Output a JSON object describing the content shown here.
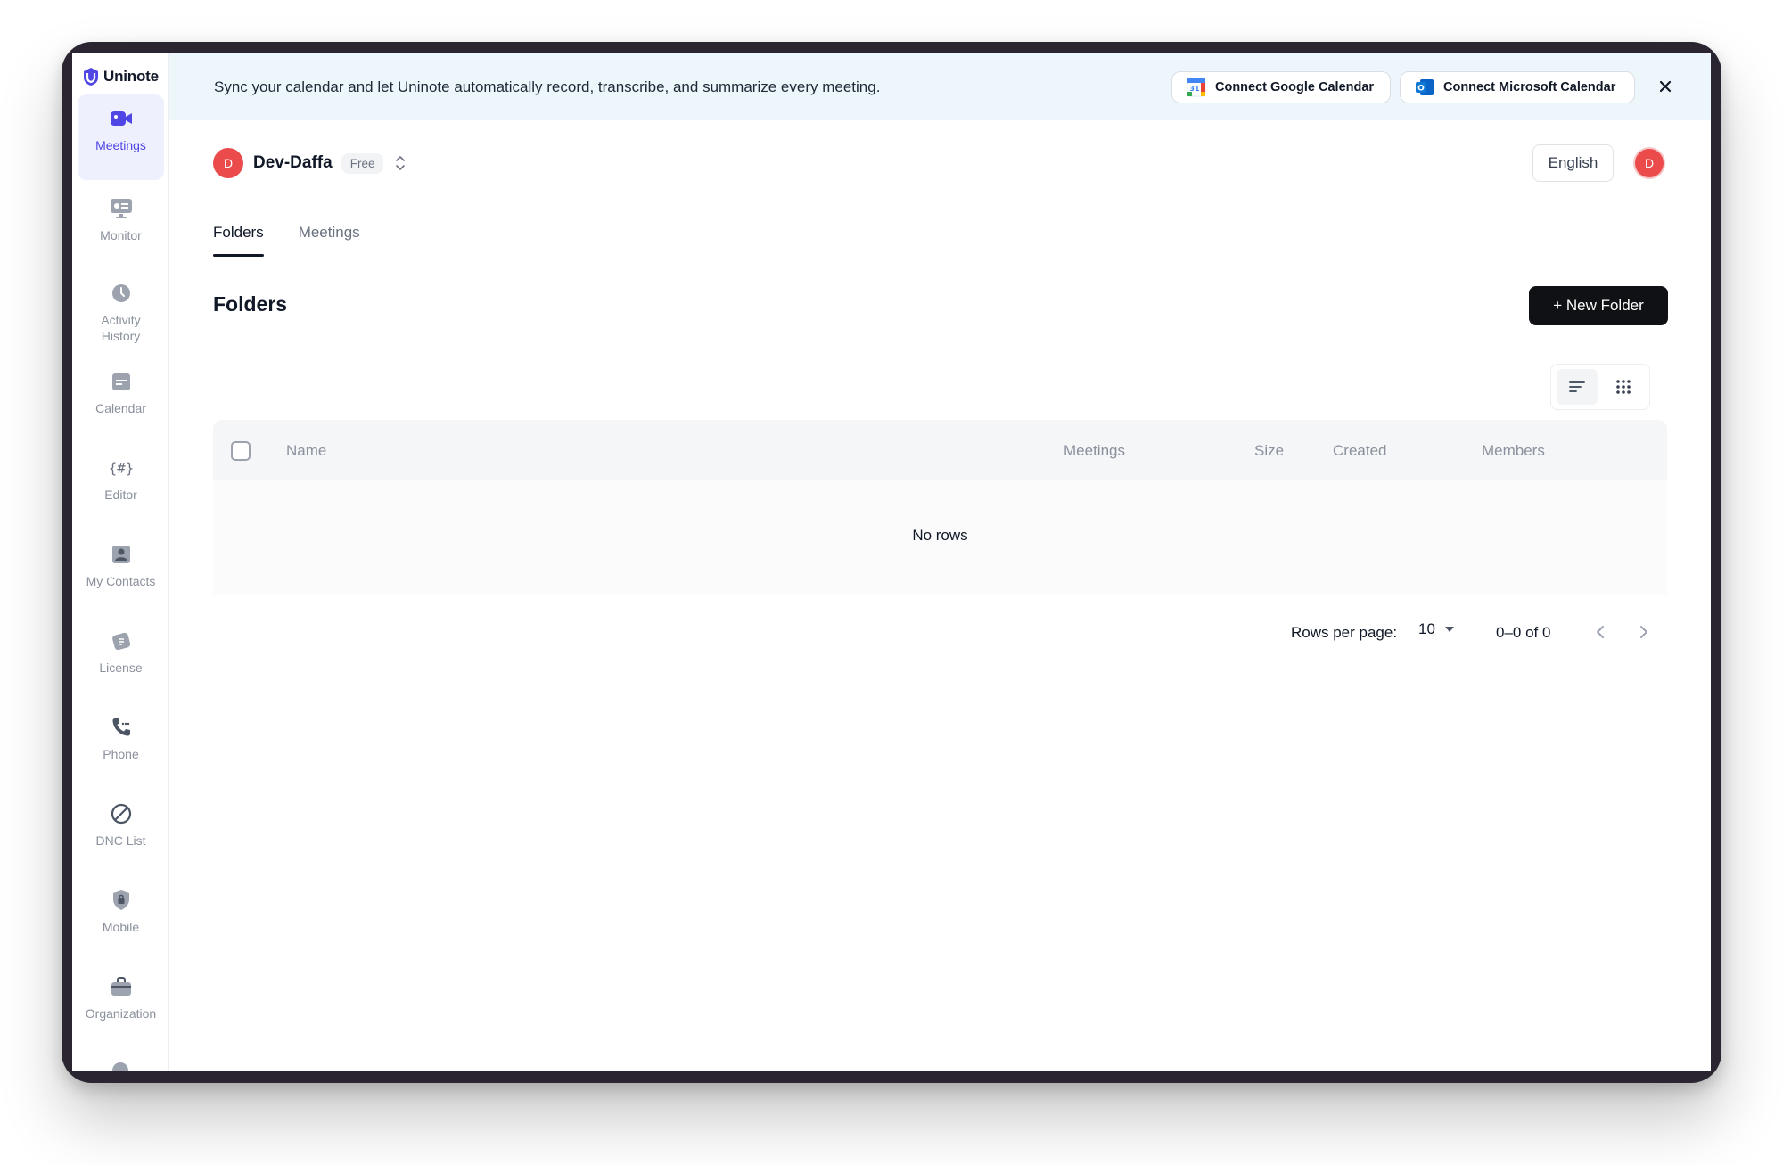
{
  "app": {
    "name": "Uninote"
  },
  "sidebar": {
    "items": [
      {
        "label": "Meetings",
        "icon": "video-camera-icon",
        "active": true
      },
      {
        "label": "Monitor",
        "icon": "monitor-icon"
      },
      {
        "label": "Activity History",
        "icon": "clock-icon"
      },
      {
        "label": "Calendar",
        "icon": "calendar-icon"
      },
      {
        "label": "Editor",
        "icon": "hash-braces-icon"
      },
      {
        "label": "My Contacts",
        "icon": "contact-icon"
      },
      {
        "label": "License",
        "icon": "license-icon"
      },
      {
        "label": "Phone",
        "icon": "phone-icon"
      },
      {
        "label": "DNC List",
        "icon": "no-entry-icon"
      },
      {
        "label": "Mobile",
        "icon": "mobile-lock-icon"
      },
      {
        "label": "Organization",
        "icon": "briefcase-icon"
      }
    ]
  },
  "banner": {
    "text": "Sync your calendar and let Uninote automatically record, transcribe, and summarize every meeting.",
    "google_label": "Connect Google Calendar",
    "microsoft_label": "Connect Microsoft Calendar"
  },
  "workspace": {
    "initial": "D",
    "name": "Dev-Daffa",
    "plan": "Free"
  },
  "header": {
    "language": "English",
    "user_initial": "D"
  },
  "tabs": [
    {
      "label": "Folders",
      "active": true
    },
    {
      "label": "Meetings",
      "active": false
    }
  ],
  "main": {
    "title": "Folders",
    "new_folder_label": "+ New Folder"
  },
  "table": {
    "columns": [
      "Name",
      "Meetings",
      "Size",
      "Created",
      "Members"
    ],
    "empty_text": "No rows"
  },
  "pagination": {
    "rows_per_page_label": "Rows per page:",
    "rows_per_page": "10",
    "range": "0–0 of 0"
  },
  "colors": {
    "accent": "#4f46e5",
    "avatar": "#ec4b4b",
    "banner_bg": "#edf7fb",
    "primary_button": "#0f1115"
  }
}
